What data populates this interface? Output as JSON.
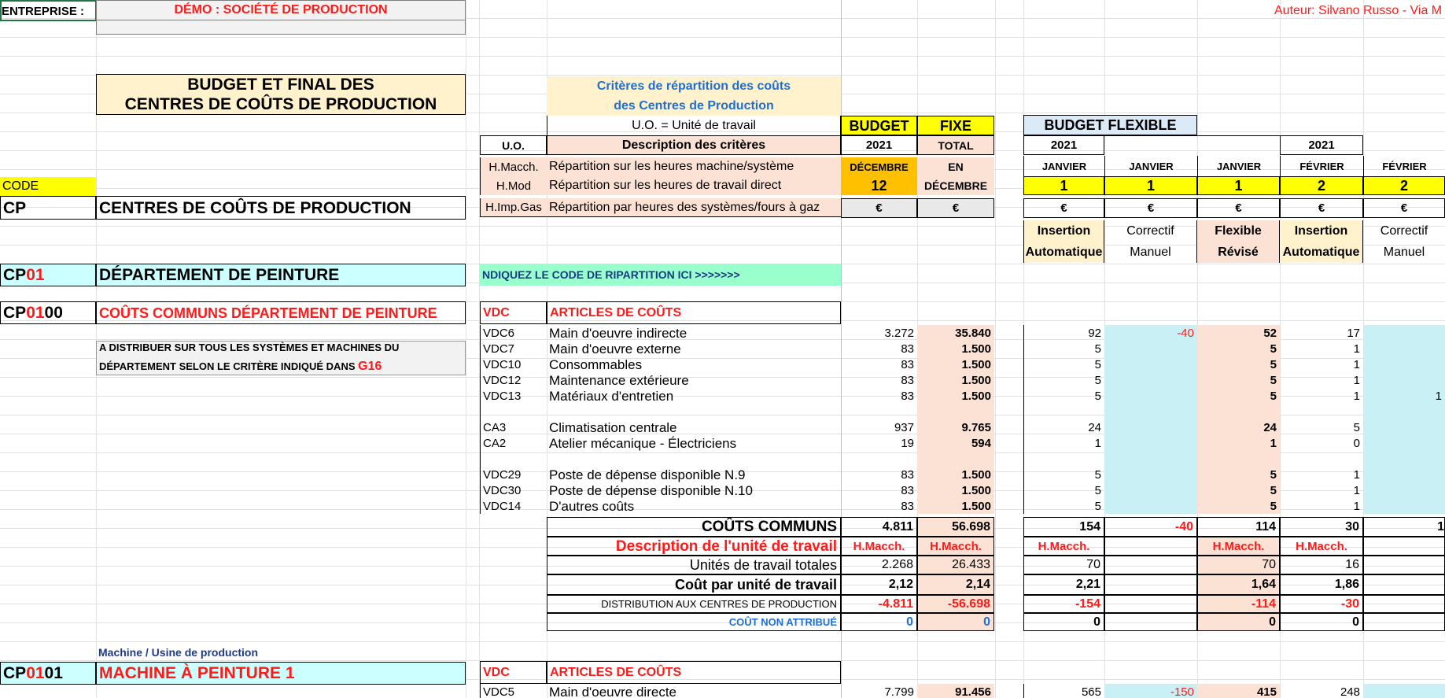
{
  "header": {
    "company_label": "ENTREPRISE :",
    "company_name": "DÉMO : SOCIÉTÉ DE PRODUCTION",
    "author": "Auteur: Silvano Russo - Via M"
  },
  "title": {
    "line1": "BUDGET ET FINAL DES",
    "line2": "CENTRES DE COÛTS DE PRODUCTION"
  },
  "criteria": {
    "title1": "Critères de répartition des coûts",
    "title2": "des Centres de Production",
    "uo_def": "U.O. = Unité de travail",
    "col_uo": "U.O.",
    "col_desc": "Description des critères",
    "rows": [
      {
        "code": "H.Macch.",
        "desc": "Répartition sur les heures machine/système"
      },
      {
        "code": "H.Mod",
        "desc": "Répartition sur les heures de travail direct"
      },
      {
        "code": "H.Imp.Gas",
        "desc": "Répartition par heures des systèmes/fours à gaz"
      }
    ]
  },
  "budget_hdr": {
    "budget": "BUDGET",
    "fixe": "FIXE",
    "year": "2021",
    "total": "TOTAL",
    "month": "DÉCEMBRE",
    "en": "EN",
    "month_num": "12",
    "en_month": "DÉCEMBRE",
    "euro1": "€",
    "euro2": "€"
  },
  "flex_hdr": {
    "title": "BUDGET FLEXIBLE",
    "years": [
      "2021",
      "",
      "",
      "2021",
      ""
    ],
    "months": [
      "JANVIER",
      "JANVIER",
      "JANVIER",
      "FÉVRIER",
      "FÉVRIER"
    ],
    "nums": [
      "1",
      "1",
      "1",
      "2",
      "2"
    ],
    "euros": [
      "€",
      "€",
      "€",
      "€",
      "€"
    ],
    "type1": [
      "Insertion",
      "Correctif",
      "Flexible",
      "Insertion",
      "Correctif"
    ],
    "type2": [
      "Automatique",
      "Manuel",
      "Révisé",
      "Automatique",
      "Manuel"
    ]
  },
  "code_row": {
    "code": "CODE",
    "cp": "CP",
    "cp_title": "CENTRES DE COÛTS DE PRODUCTION"
  },
  "dept": {
    "code_prefix": "CP",
    "code_suffix": "01",
    "name": "DÉPARTEMENT DE PEINTURE",
    "instruction": "NDIQUEZ LE CODE DE RIPARTITION ICI >>>>>>>"
  },
  "common": {
    "code_prefix": "CP",
    "code_mid": "01",
    "code_end": "00",
    "name": "COÛTS COMMUNS DÉPARTEMENT DE PEINTURE",
    "note1": "A DISTRIBUER SUR TOUS LES SYSTÈMES ET MACHINES DU",
    "note2": "DÉPARTEMENT SELON LE CRITÈRE INDIQUÉ DANS ",
    "note_ref": "G16",
    "vdc": "VDC",
    "articles": "ARTICLES DE COÛTS",
    "rows": [
      {
        "code": "VDC6",
        "label": "Main d'oeuvre indirecte",
        "v": [
          "3.272",
          "35.840",
          "92",
          "-40",
          "52",
          "17",
          ""
        ]
      },
      {
        "code": "VDC7",
        "label": "Main d'oeuvre externe",
        "v": [
          "83",
          "1.500",
          "5",
          "",
          "5",
          "1",
          ""
        ]
      },
      {
        "code": "VDC10",
        "label": "Consommables",
        "v": [
          "83",
          "1.500",
          "5",
          "",
          "5",
          "1",
          ""
        ]
      },
      {
        "code": "VDC12",
        "label": "Maintenance extérieure",
        "v": [
          "83",
          "1.500",
          "5",
          "",
          "5",
          "1",
          ""
        ]
      },
      {
        "code": "VDC13",
        "label": "Matériaux d'entretien",
        "v": [
          "83",
          "1.500",
          "5",
          "",
          "5",
          "1",
          "1"
        ]
      },
      {
        "code": "",
        "label": "",
        "v": [
          "",
          "",
          "",
          "",
          "",
          "",
          ""
        ]
      },
      {
        "code": "CA3",
        "label": "Climatisation centrale",
        "v": [
          "937",
          "9.765",
          "24",
          "",
          "24",
          "5",
          ""
        ]
      },
      {
        "code": "CA2",
        "label": "Atelier mécanique - Électriciens",
        "v": [
          "19",
          "594",
          "1",
          "",
          "1",
          "0",
          ""
        ]
      },
      {
        "code": "",
        "label": "",
        "v": [
          "",
          "",
          "",
          "",
          "",
          "",
          ""
        ]
      },
      {
        "code": "VDC29",
        "label": "Poste de dépense disponible N.9",
        "v": [
          "83",
          "1.500",
          "5",
          "",
          "5",
          "1",
          ""
        ]
      },
      {
        "code": "VDC30",
        "label": "Poste de dépense disponible N.10",
        "v": [
          "83",
          "1.500",
          "5",
          "",
          "5",
          "1",
          ""
        ]
      },
      {
        "code": "VDC14",
        "label": "D'autres coûts",
        "v": [
          "83",
          "1.500",
          "5",
          "",
          "5",
          "1",
          ""
        ]
      }
    ],
    "totals": {
      "label": "COÛTS COMMUNS",
      "v": [
        "4.811",
        "56.698",
        "154",
        "-40",
        "114",
        "30",
        "1"
      ]
    },
    "uo_row": {
      "label": "Description de l'unité de travail",
      "v": [
        "H.Macch.",
        "H.Macch.",
        "H.Macch.",
        "",
        "H.Macch.",
        "H.Macch.",
        ""
      ]
    },
    "units_row": {
      "label": "Unités de travail totales",
      "v": [
        "2.268",
        "26.433",
        "70",
        "",
        "70",
        "16",
        ""
      ]
    },
    "cost_row": {
      "label": "Coût par unité de travail",
      "v": [
        "2,12",
        "2,14",
        "2,21",
        "",
        "1,64",
        "1,86",
        ""
      ]
    },
    "dist_row": {
      "label": "DISTRIBUTION AUX CENTRES DE PRODUCTION",
      "v": [
        "-4.811",
        "-56.698",
        "-154",
        "",
        "-114",
        "-30",
        ""
      ]
    },
    "nonattr_row": {
      "label": "COÛT NON ATTRIBUÉ",
      "v": [
        "0",
        "0",
        "0",
        "",
        "0",
        "0",
        ""
      ]
    }
  },
  "machine": {
    "caption": "Machine / Usine de production",
    "code_prefix": "CP",
    "code_mid": "01",
    "code_end": "01",
    "name": "MACHINE À PEINTURE 1",
    "vdc": "VDC",
    "articles": "ARTICLES DE COÛTS",
    "row": {
      "code": "VDC5",
      "label": "Main d'oeuvre directe",
      "v": [
        "7.799",
        "91.456",
        "565",
        "-150",
        "415",
        "248",
        ""
      ]
    }
  },
  "colors": {
    "red": "#ff1a1a",
    "peach": "#fbe2d5",
    "yellow": "#ffff00",
    "orange": "#ffc000",
    "cream": "#fff2cc",
    "cyan": "#ccffff",
    "green": "#99ffcc"
  }
}
